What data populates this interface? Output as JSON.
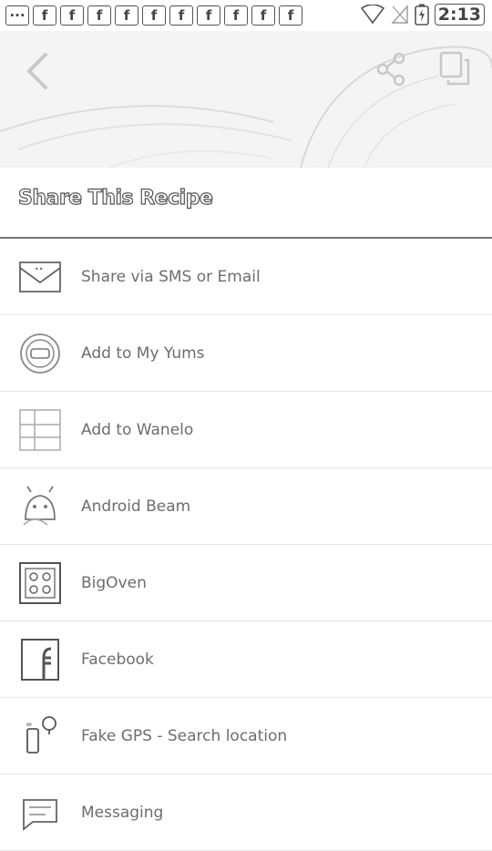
{
  "status_bar": {
    "notification_icons": [
      "more-icon",
      "facebook-icon",
      "facebook-icon",
      "facebook-icon",
      "facebook-icon",
      "facebook-icon",
      "facebook-icon",
      "facebook-icon",
      "facebook-icon",
      "facebook-icon",
      "facebook-icon"
    ],
    "time": "2:13"
  },
  "header": {
    "back_icon": "chevron-left-icon",
    "share_icon": "share-icon",
    "copy_icon": "copy-icon"
  },
  "sheet": {
    "title": "Share This Recipe",
    "items": [
      {
        "label": "Share via SMS or Email",
        "icon": "envelope-icon"
      },
      {
        "label": "Add to My Yums",
        "icon": "yummly-icon"
      },
      {
        "label": "Add to Wanelo",
        "icon": "wanelo-icon"
      },
      {
        "label": "Android Beam",
        "icon": "android-beam-icon"
      },
      {
        "label": "BigOven",
        "icon": "bigoven-icon"
      },
      {
        "label": "Facebook",
        "icon": "facebook-icon"
      },
      {
        "label": "Fake GPS - Search location",
        "icon": "fake-gps-icon"
      },
      {
        "label": "Messaging",
        "icon": "messaging-icon"
      }
    ]
  }
}
